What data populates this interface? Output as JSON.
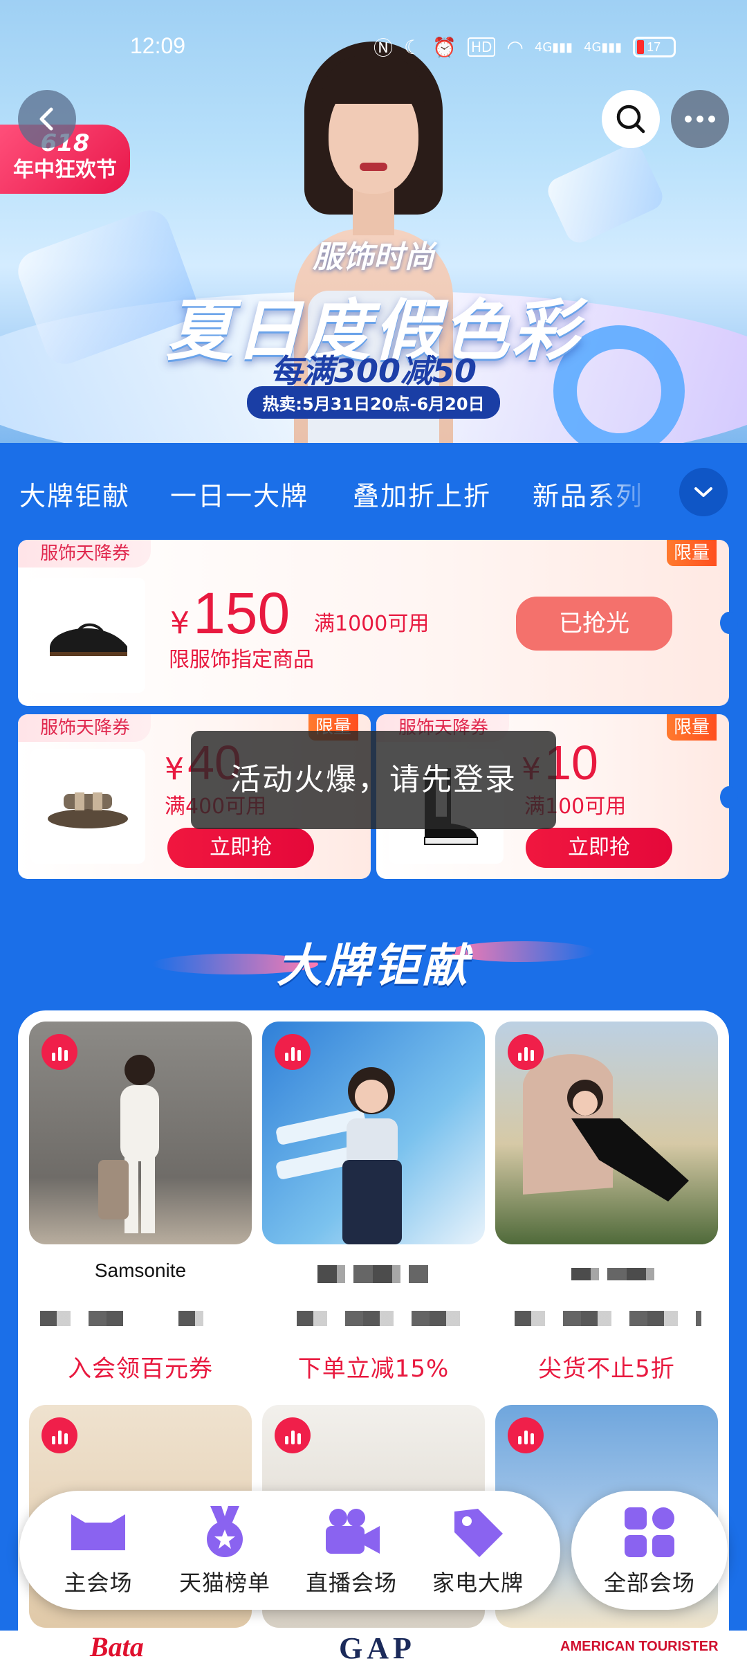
{
  "status_bar": {
    "time": "12:09",
    "battery": "17",
    "signal1": "4G",
    "signal2": "4G"
  },
  "hero": {
    "badge_number": "618",
    "badge_text": "年中狂欢节",
    "subtitle": "服饰时尚",
    "title": "夏日度假色彩",
    "offer": "每满300减50",
    "date": "热卖:5月31日20点-6月20日"
  },
  "tabs": [
    "大牌钜献",
    "一日一大牌",
    "叠加折上折",
    "新品系列"
  ],
  "coupons": {
    "main": {
      "tag": "服饰天降券",
      "limit": "限量",
      "currency": "¥",
      "amount": "150",
      "condition": "满1000可用",
      "note": "限服饰指定商品",
      "button": "已抢光"
    },
    "left": {
      "tag": "服饰天降券",
      "limit": "限量",
      "currency": "¥",
      "amount": "40",
      "condition": "满400可用",
      "button": "立即抢"
    },
    "right": {
      "tag": "服饰天降券",
      "limit": "限量",
      "currency": "¥",
      "amount": "10",
      "condition": "满100可用",
      "button": "立即抢"
    }
  },
  "toast": "活动火爆，请先登录",
  "section": {
    "title": "大牌钜献"
  },
  "brands": [
    {
      "logo": "Samsonite",
      "promo": "入会领百元券"
    },
    {
      "logo": "",
      "promo": "下单立减15%"
    },
    {
      "logo": "",
      "promo": "尖货不止5折"
    }
  ],
  "brand_row2_logos": [
    "Bata",
    "GAP",
    "AMERICAN TOURISTER"
  ],
  "bottom_nav": {
    "items": [
      "主会场",
      "天猫榜单",
      "直播会场",
      "家电大牌"
    ],
    "all": "全部会场"
  },
  "colors": {
    "accent": "#e8193f",
    "background": "#1b6fe8",
    "nav_icon": "#8a63f0"
  },
  "icons": [
    "back-icon",
    "search-icon",
    "more-icon",
    "chevron-down-icon",
    "live-icon",
    "cat-head-icon",
    "medal-icon",
    "video-camera-icon",
    "tag-icon",
    "grid-icon"
  ]
}
